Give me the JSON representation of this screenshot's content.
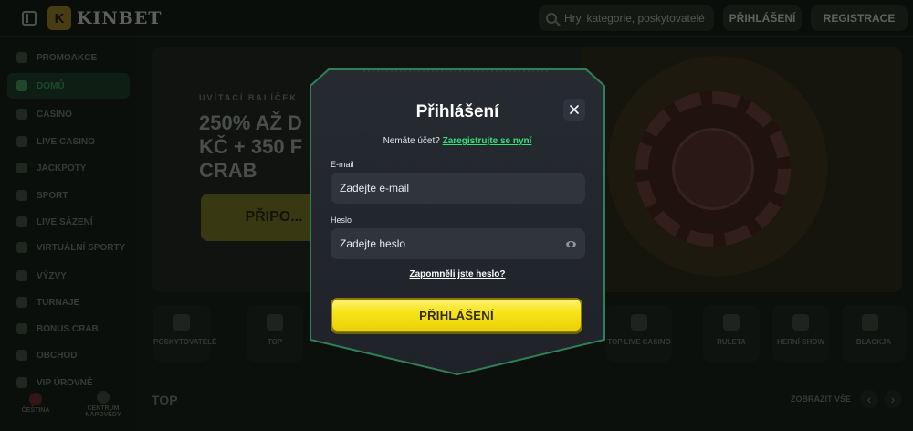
{
  "app": {
    "logo_text": "KINBET",
    "logo_badge": "K"
  },
  "header": {
    "search_placeholder": "Hry, kategorie, poskytovatelé",
    "login_label": "PŘIHLÁŠENÍ",
    "register_label": "REGISTRACE"
  },
  "sidebar": {
    "items": [
      {
        "label": "PROMOAKCE"
      },
      {
        "label": "DOMŮ",
        "active": true
      },
      {
        "label": "CASINO"
      },
      {
        "label": "LIVE CASINO"
      },
      {
        "label": "JACKPOTY"
      },
      {
        "label": "SPORT"
      },
      {
        "label": "LIVE SÁZENÍ"
      },
      {
        "label": "VIRTUÁLNÍ SPORTY"
      },
      {
        "label": "VÝZVY"
      },
      {
        "label": "TURNAJE"
      },
      {
        "label": "BONUS CRAB"
      },
      {
        "label": "OBCHOD"
      },
      {
        "label": "VIP ÚROVNĚ"
      }
    ],
    "language_label": "ČEŠTINA",
    "help_label": "CENTRUM NÁPOVĚDY"
  },
  "banner": {
    "kicker": "UVÍTACÍ BALÍČEK",
    "title_lines": [
      "250% AŽ D",
      "KČ + 350 F",
      "CRAB"
    ],
    "cta_label": "PŘIPO..."
  },
  "categories": [
    {
      "label": "POSKYTOVATELÉ"
    },
    {
      "label": "TOP"
    },
    {
      "label": "TOP LIVE CASINO"
    },
    {
      "label": "RULETA"
    },
    {
      "label": "HERNÍ SHOW"
    },
    {
      "label": "BLACKJA"
    }
  ],
  "section": {
    "title": "TOP",
    "show_all": "ZOBRAZIT VŠE"
  },
  "modal": {
    "title": "Přihlášení",
    "no_account_text": "Nemáte účet?",
    "register_link": "Zaregistrujte se nyní",
    "email_label": "E-mail",
    "email_placeholder": "Zadejte e-mail",
    "password_label": "Heslo",
    "password_placeholder": "Zadejte heslo",
    "forgot_link": "Zapomněli jste heslo?",
    "submit_label": "PŘIHLÁŠENÍ"
  },
  "colors": {
    "accent_green": "#35e07a",
    "submit_yellow": "#f7e419",
    "modal_bg": "#22272e"
  }
}
